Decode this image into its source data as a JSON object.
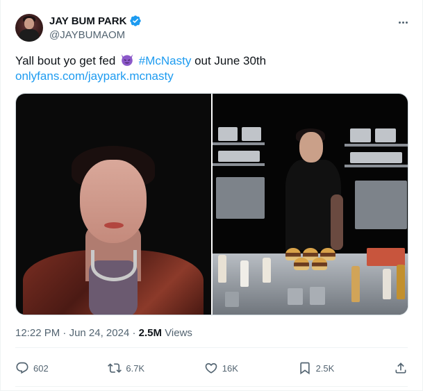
{
  "author": {
    "display_name": "JAY BUM PARK",
    "handle": "@JAYBUMAOM",
    "verified": true,
    "avatar_icon": "avatar-photo"
  },
  "tweet": {
    "text_before": "Yall bout yo get fed",
    "emoji": "smiling-devil-emoji",
    "hashtag": "#McNasty",
    "text_after": "out June 30th",
    "url": "onlyfans.com/jaypark.mcnasty"
  },
  "media": [
    {
      "icon": "portrait-photo"
    },
    {
      "icon": "kitchen-photo"
    }
  ],
  "meta": {
    "time": "12:22 PM",
    "separator": "·",
    "date": "Jun 24, 2024",
    "views_count": "2.5M",
    "views_label": "Views"
  },
  "actions": {
    "replies": "602",
    "reposts": "6.7K",
    "likes": "16K",
    "bookmarks": "2.5K"
  },
  "colors": {
    "accent": "#1d9bf0",
    "text": "#0f1419",
    "secondary": "#536471",
    "emoji": "#8b58c9"
  }
}
